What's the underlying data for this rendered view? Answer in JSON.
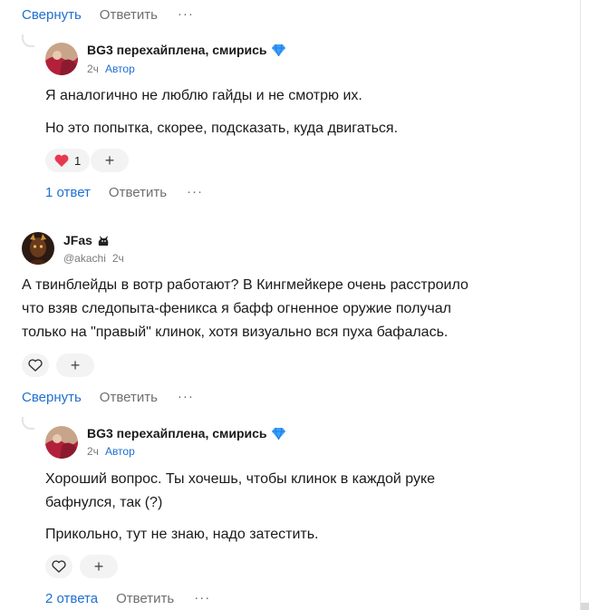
{
  "top_actions": {
    "collapse": "Свернуть",
    "reply": "Ответить",
    "more": "···"
  },
  "reply1": {
    "author": "BG3 перехайплена, смирись",
    "time": "2ч",
    "badge": "Автор",
    "paragraph1": "Я аналогично не люблю гайды и не смотрю их.",
    "paragraph2": "Но это попытка, скорее, подсказать, куда двигаться.",
    "reaction_count": "1",
    "add_reaction": "+",
    "replies": "1 ответ",
    "reply": "Ответить",
    "more": "···"
  },
  "comment2": {
    "author": "JFas",
    "handle": "@akachi",
    "time": "2ч",
    "line1": "А твинблейды в вотр работают? В Кингмейкере очень расстроило",
    "line2": "что взяв следопыта-феникса я бафф огненное оружие получал",
    "line3": "только на \"правый\" клинок, хотя визуально вся пуха бафалась.",
    "add_reaction": "+",
    "collapse": "Свернуть",
    "reply": "Ответить",
    "more": "···"
  },
  "reply2": {
    "author": "BG3 перехайплена, смирись",
    "time": "2ч",
    "badge": "Автор",
    "line1": "Хороший вопрос. Ты хочешь, чтобы клинок в каждой руке",
    "line2": "бафнулся, так (?)",
    "paragraph2": "Прикольно, тут не знаю, надо затестить.",
    "add_reaction": "+",
    "replies": "2 ответа",
    "reply": "Ответить",
    "more": "···"
  },
  "colors": {
    "link_blue": "#1f6fd1",
    "gem": "#3aa0ff",
    "heart": "#e8384f"
  }
}
